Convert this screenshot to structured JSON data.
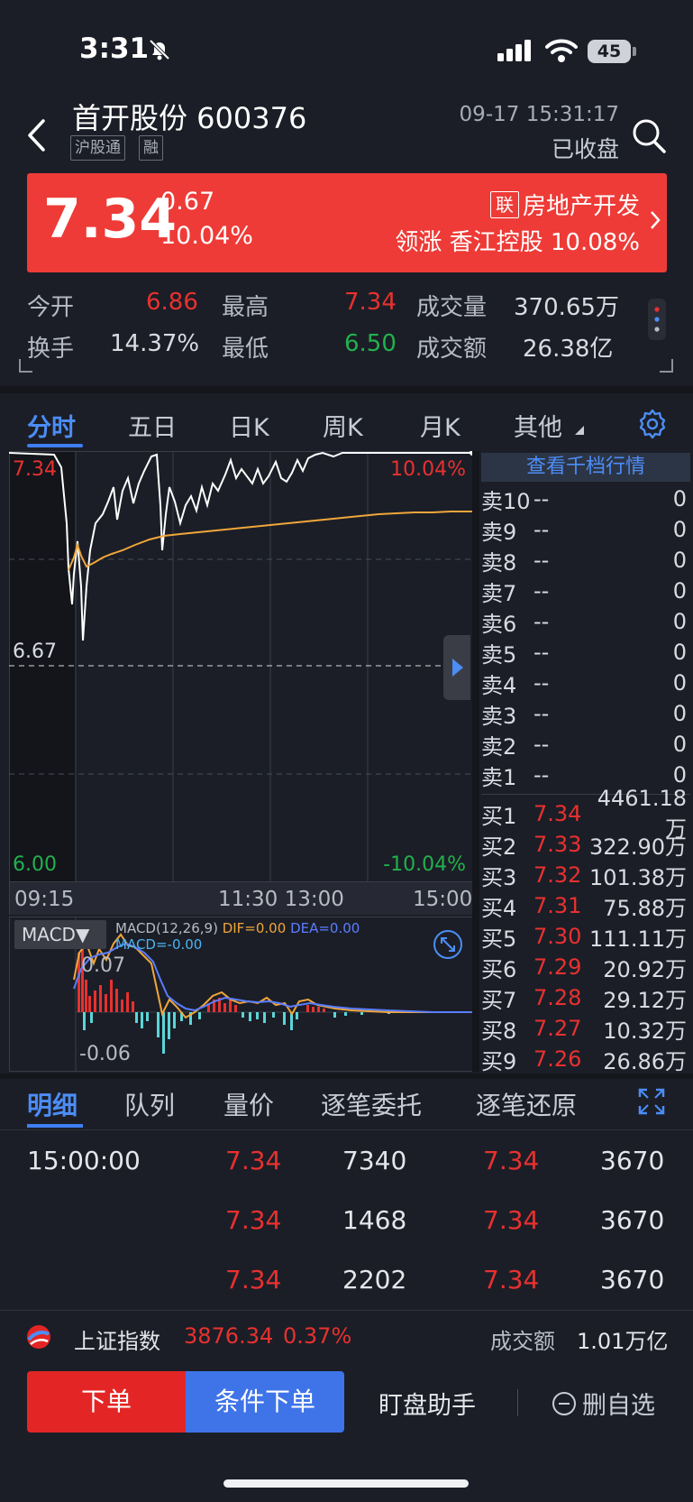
{
  "status": {
    "time": "3:31",
    "battery": "45"
  },
  "header": {
    "name": "首开股份 600376",
    "tags": [
      "沪股通",
      "融"
    ],
    "datetime": "09-17 15:31:17",
    "market_status": "已收盘"
  },
  "quote": {
    "price": "7.34",
    "change": "0.67",
    "change_pct": "10.04%",
    "lian": "联",
    "sector": "房地产开发",
    "leader": "领涨 香江控股 10.08%"
  },
  "stats": {
    "open_label": "今开",
    "open": "6.86",
    "high_label": "最高",
    "high": "7.34",
    "vol_label": "成交量",
    "vol": "370.65万",
    "turn_label": "换手",
    "turn": "14.37%",
    "low_label": "最低",
    "low": "6.50",
    "amt_label": "成交额",
    "amt": "26.38亿"
  },
  "tabs": [
    "分时",
    "五日",
    "日K",
    "周K",
    "月K",
    "其他"
  ],
  "chart": {
    "top_price": "7.34",
    "top_pct": "10.04%",
    "mid_price": "6.67",
    "bottom_price": "6.00",
    "bottom_pct": "-10.04%",
    "times": [
      "09:15",
      "11:30 13:00",
      "15:00"
    ],
    "macd_btn": "MACD▼",
    "macd_params": "MACD(12,26,9)",
    "dif": "DIF=0.00",
    "dea": "DEA=0.00",
    "macd_val": "MACD=-0.00",
    "macd_top": "0.07",
    "macd_bottom": "-0.06",
    "colors": {
      "price_line": "#ffffff",
      "avg_line": "#f0a63a",
      "up": "#e8312f",
      "down": "#5ad6d8"
    }
  },
  "order_book": {
    "depth_btn": "查看千档行情",
    "sell": [
      {
        "side": "卖10",
        "price": "--",
        "vol": "0"
      },
      {
        "side": "卖9",
        "price": "--",
        "vol": "0"
      },
      {
        "side": "卖8",
        "price": "--",
        "vol": "0"
      },
      {
        "side": "卖7",
        "price": "--",
        "vol": "0"
      },
      {
        "side": "卖6",
        "price": "--",
        "vol": "0"
      },
      {
        "side": "卖5",
        "price": "--",
        "vol": "0"
      },
      {
        "side": "卖4",
        "price": "--",
        "vol": "0"
      },
      {
        "side": "卖3",
        "price": "--",
        "vol": "0"
      },
      {
        "side": "卖2",
        "price": "--",
        "vol": "0"
      },
      {
        "side": "卖1",
        "price": "--",
        "vol": "0"
      }
    ],
    "buy": [
      {
        "side": "买1",
        "price": "7.34",
        "vol": "4461.18万"
      },
      {
        "side": "买2",
        "price": "7.33",
        "vol": "322.90万"
      },
      {
        "side": "买3",
        "price": "7.32",
        "vol": "101.38万"
      },
      {
        "side": "买4",
        "price": "7.31",
        "vol": "75.88万"
      },
      {
        "side": "买5",
        "price": "7.30",
        "vol": "111.11万"
      },
      {
        "side": "买6",
        "price": "7.29",
        "vol": "20.92万"
      },
      {
        "side": "买7",
        "price": "7.28",
        "vol": "29.12万"
      },
      {
        "side": "买8",
        "price": "7.27",
        "vol": "10.32万"
      },
      {
        "side": "买9",
        "price": "7.26",
        "vol": "26.86万"
      }
    ]
  },
  "detail_tabs": [
    "明细",
    "队列",
    "量价",
    "逐笔委托",
    "逐笔还原"
  ],
  "trades": [
    {
      "time": "15:00:00",
      "p1": "7.34",
      "v1": "7340",
      "p2": "7.34",
      "v2": "3670"
    },
    {
      "time": "",
      "p1": "7.34",
      "v1": "1468",
      "p2": "7.34",
      "v2": "3670"
    },
    {
      "time": "",
      "p1": "7.34",
      "v1": "2202",
      "p2": "7.34",
      "v2": "3670"
    }
  ],
  "index_bar": {
    "name": "上证指数",
    "value": "3876.34",
    "pct": "0.37%",
    "amt_label": "成交额",
    "amt": "1.01万亿"
  },
  "bottom": {
    "order": "下单",
    "cond_order": "条件下单",
    "watch": "盯盘助手",
    "remove": "删自选"
  }
}
